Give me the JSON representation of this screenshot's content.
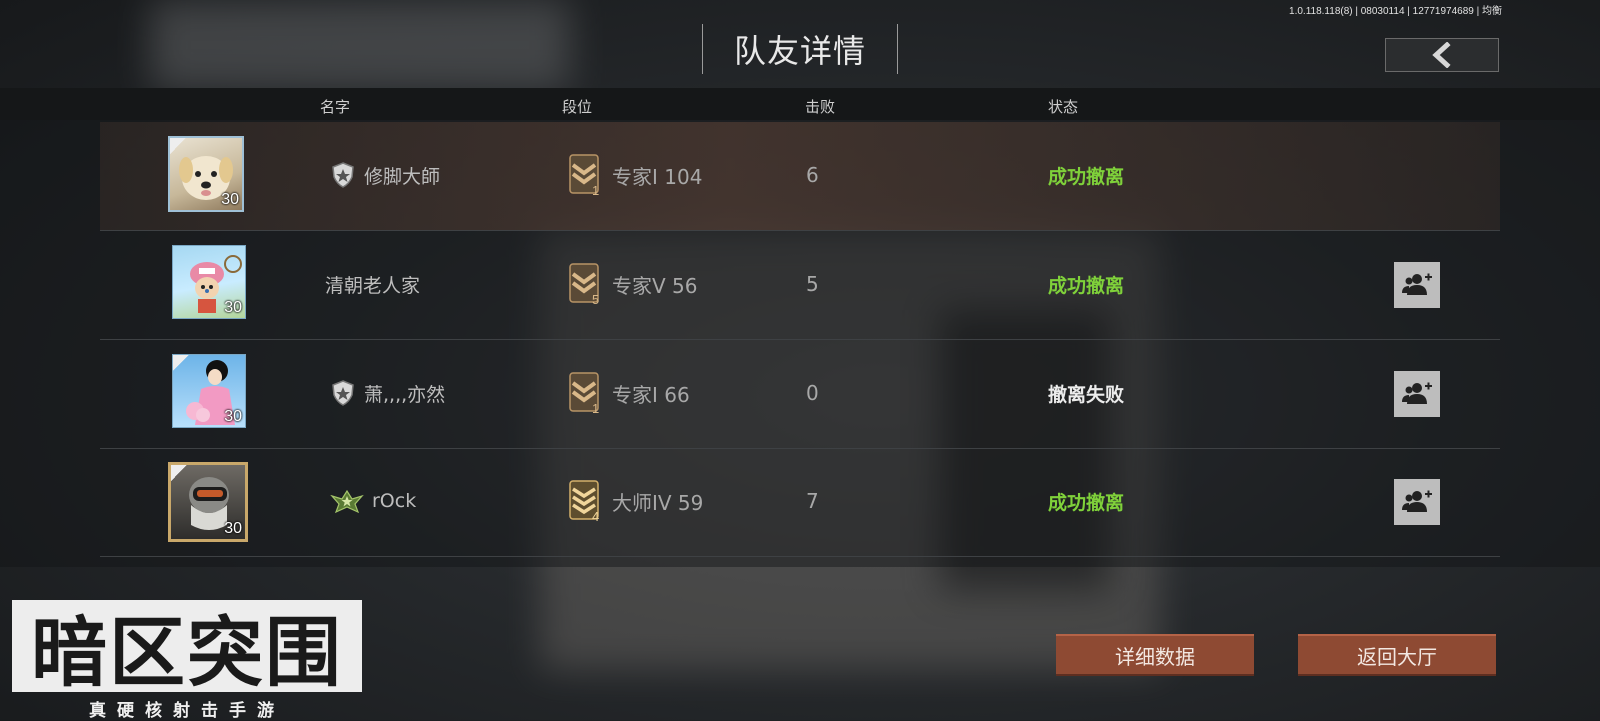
{
  "version": "1.0.118.118(8) | 08030114 | 12771974689 | 均衡",
  "title": "队友详情",
  "columns": {
    "name": "名字",
    "rank": "段位",
    "kills": "击败",
    "status": "状态"
  },
  "colors": {
    "success": "#7fd13a",
    "fail": "#ececec",
    "button": "#8e4a33"
  },
  "players": [
    {
      "name": "修脚大師",
      "has_badge": true,
      "badge_icon": "shield-badge-icon",
      "level": "30",
      "rank": "专家I 104",
      "rank_tier": "1",
      "kills": "6",
      "status": "成功撤离",
      "status_type": "success",
      "add_friend": false
    },
    {
      "name": "清朝老人家",
      "has_badge": false,
      "level": "30",
      "rank": "专家V 56",
      "rank_tier": "5",
      "kills": "5",
      "status": "成功撤离",
      "status_type": "success",
      "add_friend": true
    },
    {
      "name": "萧,,,,亦然",
      "has_badge": true,
      "badge_icon": "shield-badge-icon",
      "level": "30",
      "rank": "专家I 66",
      "rank_tier": "1",
      "kills": "0",
      "status": "撤离失败",
      "status_type": "fail",
      "add_friend": true
    },
    {
      "name": "rOck",
      "has_badge": true,
      "badge_icon": "green-star-badge-icon",
      "level": "30",
      "rank": "大师IV 59",
      "rank_tier": "4",
      "kills": "7",
      "status": "成功撤离",
      "status_type": "success",
      "add_friend": true
    }
  ],
  "buttons": {
    "detail": "详细数据",
    "lobby": "返回大厅"
  },
  "logo": {
    "main": "暗区突围",
    "sub": "真硬核射击手游"
  }
}
